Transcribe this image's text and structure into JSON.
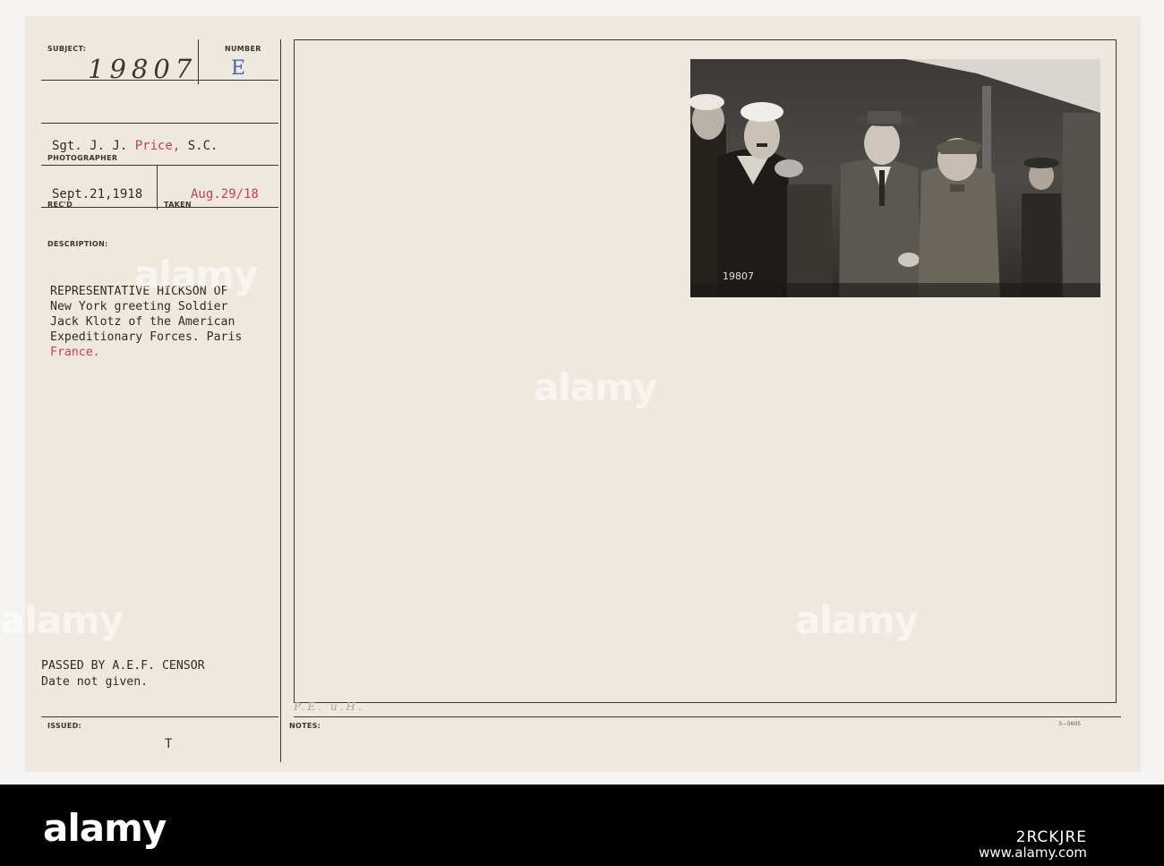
{
  "card": {
    "subject_label": "SUBJECT:",
    "subject_number": "19807",
    "number_label": "NUMBER",
    "number_value": "E",
    "photographer_name": "Sgt. J. J. ",
    "photographer_red": "Price,",
    "photographer_suffix": " S.C.",
    "photographer_label": "PHOTOGRAPHER",
    "received_date": "Sept.21,1918",
    "received_label": "REC'D",
    "taken_label": "TAKEN",
    "taken_date": "Aug.29/18",
    "description_label": "DESCRIPTION:",
    "description_lines": [
      "REPRESENTATIVE HICKSON OF",
      "New York greeting Soldier",
      "Jack Klotz of the American",
      "Expeditionary Forces. Paris"
    ],
    "description_last": "France.",
    "censor_line1": "PASSED BY A.E.F. CENSOR",
    "censor_line2": "Date not given.",
    "issued_label": "ISSUED:",
    "issued_value": "T",
    "notes_label": "NOTES:",
    "notes_handwritten": "P.E. u.H.",
    "form_number": "3—5605",
    "photo_stamp": "19807"
  },
  "watermark": {
    "brand": "alamy",
    "image_id": "2RCKJRE",
    "site": "www.alamy.com"
  },
  "colors": {
    "card_background": "#efe8df",
    "ink": "#2f2c28",
    "red_stamp": "#c8404e",
    "blue_stamp": "#3f67b6"
  }
}
